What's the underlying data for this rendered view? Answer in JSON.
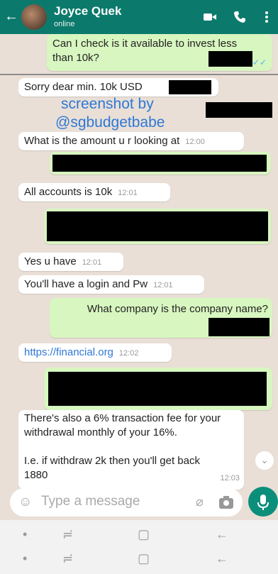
{
  "header": {
    "contact_name": "Joyce Quek",
    "status": "online"
  },
  "watermark": {
    "line1": "screenshot by",
    "line2": "@sgbudgetbabe"
  },
  "messages": [
    {
      "text": "Can I check is it available to invest less than 10k?",
      "time": ""
    },
    {
      "text": "Sorry dear min. 10k USD",
      "time": ""
    },
    {
      "text": "What is the amount u r looking at",
      "time": "12:00"
    },
    {
      "text": "All accounts is 10k",
      "time": "12:01"
    },
    {
      "text": "Yes u have",
      "time": "12:01"
    },
    {
      "text": "You'll have a login and Pw",
      "time": "12:01"
    },
    {
      "text": "What company is the company name?",
      "time": ""
    },
    {
      "text": "https://financial.org",
      "time": "12:02"
    },
    {
      "text": "There's also a 6% transaction fee for your withdrawal monthly of your 16%.",
      "time": ""
    },
    {
      "text": "I.e. if withdraw 2k then you'll get back 1880",
      "time": "12:03"
    }
  ],
  "input": {
    "placeholder": "Type a message"
  },
  "colors": {
    "header": "#0b7a6c",
    "outgoing": "#d8f6c0",
    "incoming": "#ffffff",
    "mic": "#0c8f7a"
  }
}
